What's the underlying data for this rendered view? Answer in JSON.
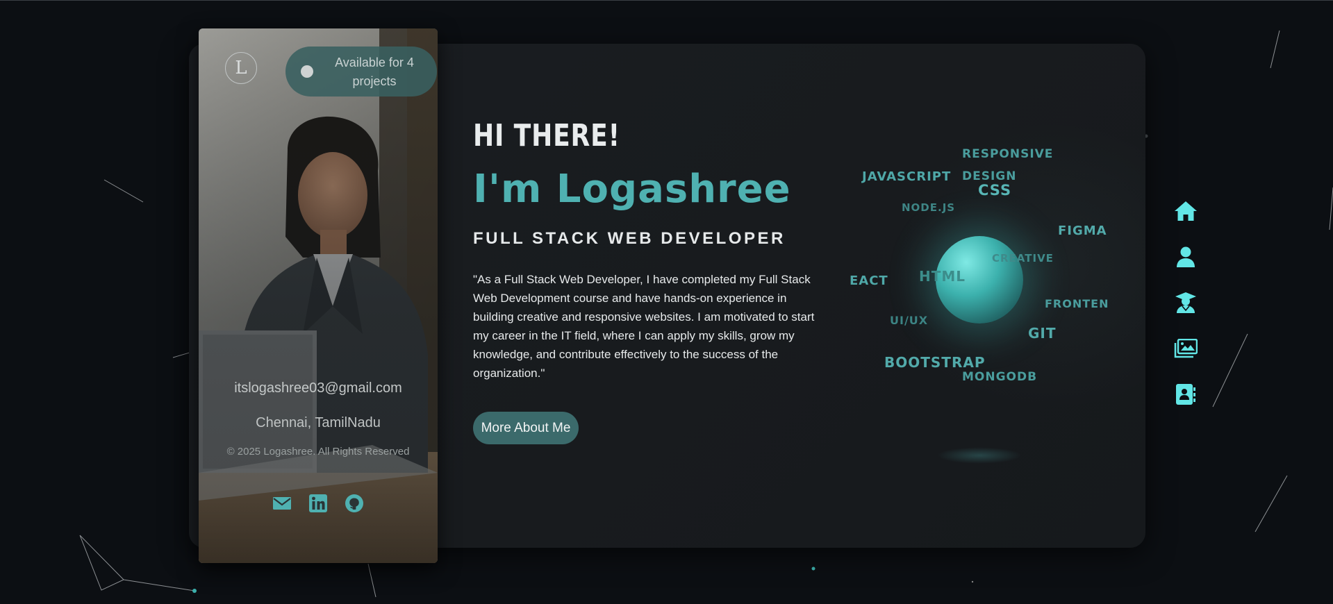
{
  "profile": {
    "logo_letter": "L",
    "availability": "Available for 4 projects",
    "email": "itslogashree03@gmail.com",
    "location": "Chennai, TamilNadu",
    "copyright": "© 2025 Logashree. All Rights Reserved",
    "socials": [
      "mail-icon",
      "linkedin-icon",
      "github-icon"
    ]
  },
  "hero": {
    "greeting": "HI THERE!",
    "name": "I'm Logashree",
    "role": "FULL STACK WEB DEVELOPER",
    "bio": "\"As a Full Stack Web Developer, I have completed my Full Stack Web Development course and have hands-on experience in building creative and responsive websites. I am motivated to start my career in the IT field, where I can apply my skills, grow my knowledge, and contribute effectively to the success of the organization.\"",
    "cta": "More About Me"
  },
  "skills": {
    "responsive": "RESPONSIVE",
    "design": "DESIGN",
    "javascript": "JAVASCRIPT",
    "css": "CSS",
    "nodejs": "NODE.JS",
    "figma": "FIGMA",
    "creative": "CREATIVE",
    "react": "EACT",
    "html": "HTML",
    "frontend": "FRONTEN",
    "uiux": "UI/UX",
    "git": "GIT",
    "bootstrap": "BOOTSTRAP",
    "mongodb": "MONGODB"
  },
  "nav": [
    "home-icon",
    "about-user-icon",
    "education-graduate-icon",
    "portfolio-gallery-icon",
    "contact-book-icon"
  ],
  "colors": {
    "accent": "#4fb1b1",
    "background": "#0c0f13",
    "card": "#1a1d21",
    "nav_icon": "#62e6e6"
  }
}
